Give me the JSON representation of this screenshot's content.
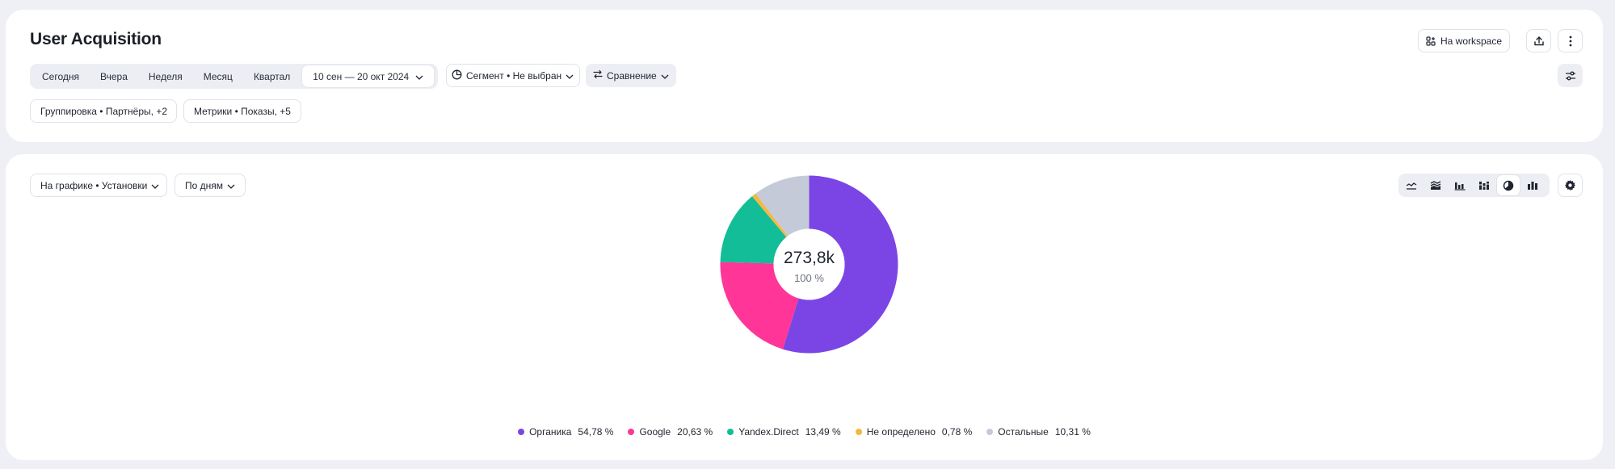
{
  "header": {
    "title": "User Acquisition",
    "workspace_label": "На workspace"
  },
  "period": {
    "options": [
      "Сегодня",
      "Вчера",
      "Неделя",
      "Месяц",
      "Квартал"
    ],
    "date_range": "10 сен — 20 окт 2024"
  },
  "segment_label": "Сегмент • Не выбран",
  "comparison_label": "Сравнение",
  "grouping_label": "Группировка • Партнёры, +2",
  "metrics_label": "Метрики • Показы, +5",
  "chart_controls": {
    "on_chart_label": "На графике • Установки",
    "granularity_label": "По дням",
    "chart_types": [
      "line-chart-icon",
      "stacked-area-icon",
      "bar-chart-icon",
      "stacked-bar-icon",
      "pie-chart-icon",
      "column-chart-icon"
    ],
    "active_chart_type": "pie-chart-icon"
  },
  "chart_data": {
    "type": "pie",
    "total_label": "273,8k",
    "total_pct": "100 %",
    "slices": [
      {
        "name": "Органика",
        "value": 54.78,
        "label": "54,78 %",
        "color": "#7b45e6"
      },
      {
        "name": "Google",
        "value": 20.63,
        "label": "20,63 %",
        "color": "#ff3597"
      },
      {
        "name": "Yandex.Direct",
        "value": 13.49,
        "label": "13,49 %",
        "color": "#12bd97"
      },
      {
        "name": "Не определено",
        "value": 0.78,
        "label": "0,78 %",
        "color": "#f5b83d"
      },
      {
        "name": "Остальные",
        "value": 10.31,
        "label": "10,31 %",
        "color": "#c4cad8"
      }
    ]
  }
}
